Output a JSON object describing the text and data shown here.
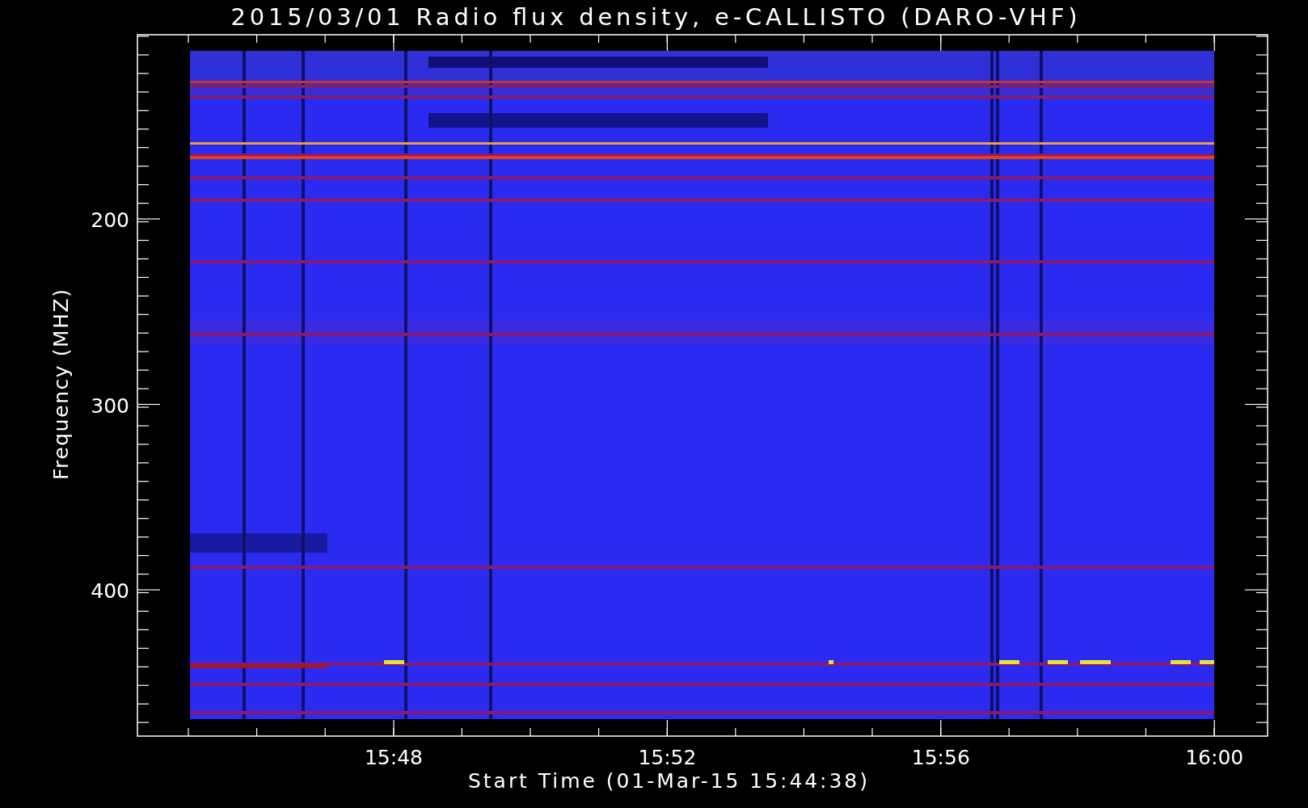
{
  "plot": {
    "title": "2015/03/01  Radio flux density, e-CALLISTO (DARO-VHF)",
    "y_axis": {
      "label": "Frequency (MHZ)",
      "ticks": [
        "200",
        "300",
        "400"
      ]
    },
    "x_axis": {
      "label": "Start Time (01-Mar-15 15:44:38)",
      "ticks": [
        "15:48",
        "15:52",
        "15:56",
        "16:00"
      ]
    }
  }
}
